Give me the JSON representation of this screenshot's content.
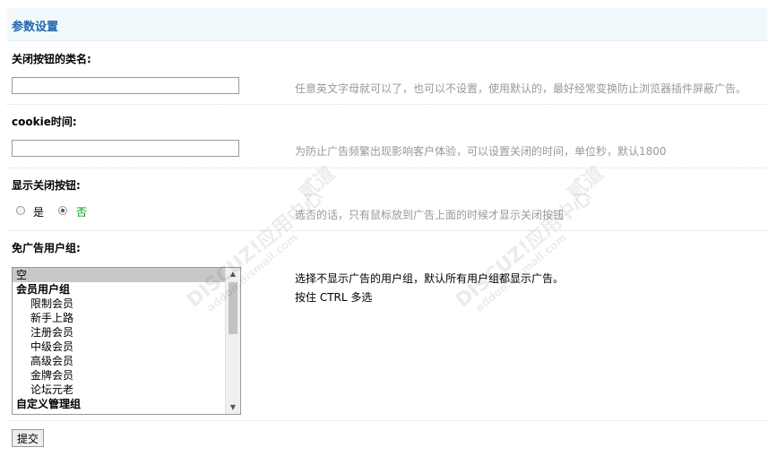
{
  "header": {
    "title": "参数设置"
  },
  "fields": {
    "close_class": {
      "label": "关闭按钮的类名:",
      "value": "",
      "tip": "任意英文字母就可以了，也可以不设置，使用默认的，最好经常变换防止浏览器插件屏蔽广告。"
    },
    "cookie_time": {
      "label": "cookie时间:",
      "value": "",
      "tip": "为防止广告频繁出现影响客户体验，可以设置关闭的时间，单位秒，默认1800"
    },
    "show_close": {
      "label": "显示关闭按钮:",
      "options": [
        "是",
        "否"
      ],
      "selected": "否",
      "tip": "选否的话，只有鼠标放到广告上面的时候才显示关闭按钮"
    },
    "ad_free_groups": {
      "label": "免广告用户组:",
      "options": [
        "空",
        "会员用户组",
        "限制会员",
        "新手上路",
        "注册会员",
        "中级会员",
        "高级会员",
        "金牌会员",
        "论坛元老",
        "自定义管理组"
      ],
      "selected": "空",
      "desc_line1": "选择不显示广告的用户组，默认所有用户组都显示广告。",
      "desc_line2": "按住 CTRL 多选"
    }
  },
  "submit_label": "提交",
  "watermark": {
    "line1": "DISCUZ!应用中心",
    "line2": "addon.dismall.com",
    "line3": "贰道"
  },
  "colors": {
    "accent": "#2366a8",
    "header_bg": "#f2f9fd",
    "selected_green": "#090"
  }
}
